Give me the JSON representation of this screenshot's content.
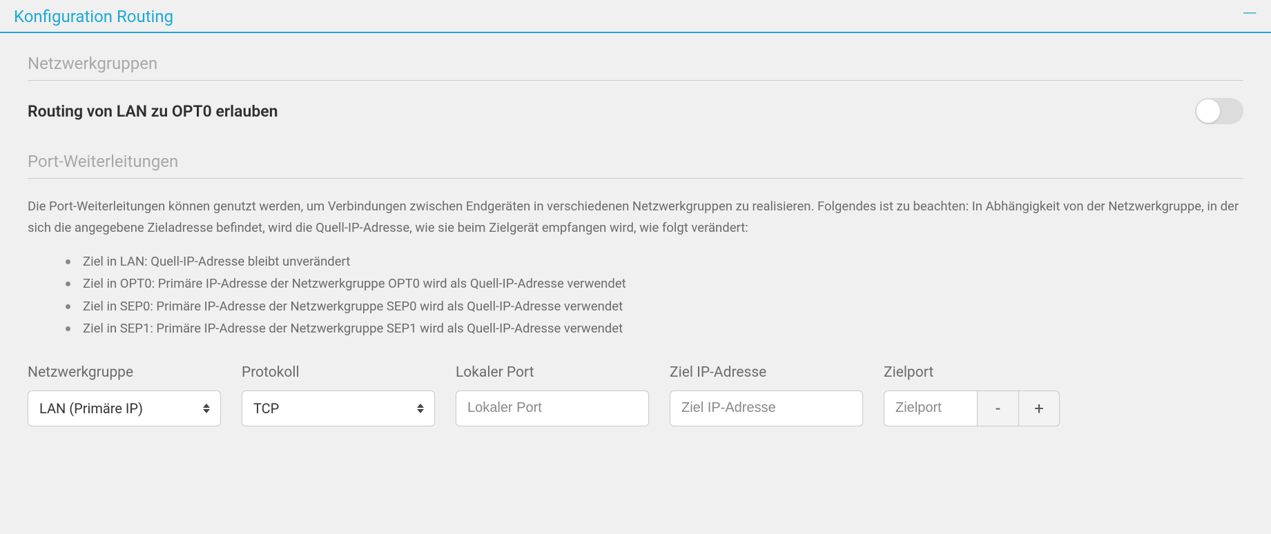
{
  "panel": {
    "title": "Konfiguration Routing"
  },
  "sections": {
    "netzwerkgruppen": "Netzwerkgruppen",
    "portweiterleitungen": "Port-Weiterleitungen"
  },
  "toggle": {
    "label": "Routing von LAN zu OPT0 erlauben",
    "state": "off"
  },
  "description": "Die Port-Weiterleitungen können genutzt werden, um Verbindungen zwischen Endgeräten in verschiedenen Netzwerkgruppen zu realisieren. Folgendes ist zu beachten: In Abhängigkeit von der Netzwerkgruppe, in der sich die angegebene Zieladresse befindet, wird die Quell-IP-Adresse, wie sie beim Zielgerät empfangen wird, wie folgt verändert:",
  "rules": [
    "Ziel in LAN: Quell-IP-Adresse bleibt unverändert",
    "Ziel in OPT0: Primäre IP-Adresse der Netzwerkgruppe OPT0 wird als Quell-IP-Adresse verwendet",
    "Ziel in SEP0: Primäre IP-Adresse der Netzwerkgruppe SEP0 wird als Quell-IP-Adresse verwendet",
    "Ziel in SEP1: Primäre IP-Adresse der Netzwerkgruppe SEP1 wird als Quell-IP-Adresse verwendet"
  ],
  "form": {
    "netzwerkgruppe": {
      "label": "Netzwerkgruppe",
      "value": "LAN (Primäre IP)"
    },
    "protokoll": {
      "label": "Protokoll",
      "value": "TCP"
    },
    "lokaler_port": {
      "label": "Lokaler Port",
      "placeholder": "Lokaler Port",
      "value": ""
    },
    "ziel_ip": {
      "label": "Ziel IP-Adresse",
      "placeholder": "Ziel IP-Adresse",
      "value": ""
    },
    "zielport": {
      "label": "Zielport",
      "placeholder": "Zielport",
      "value": ""
    },
    "buttons": {
      "remove": "-",
      "add": "+"
    }
  }
}
